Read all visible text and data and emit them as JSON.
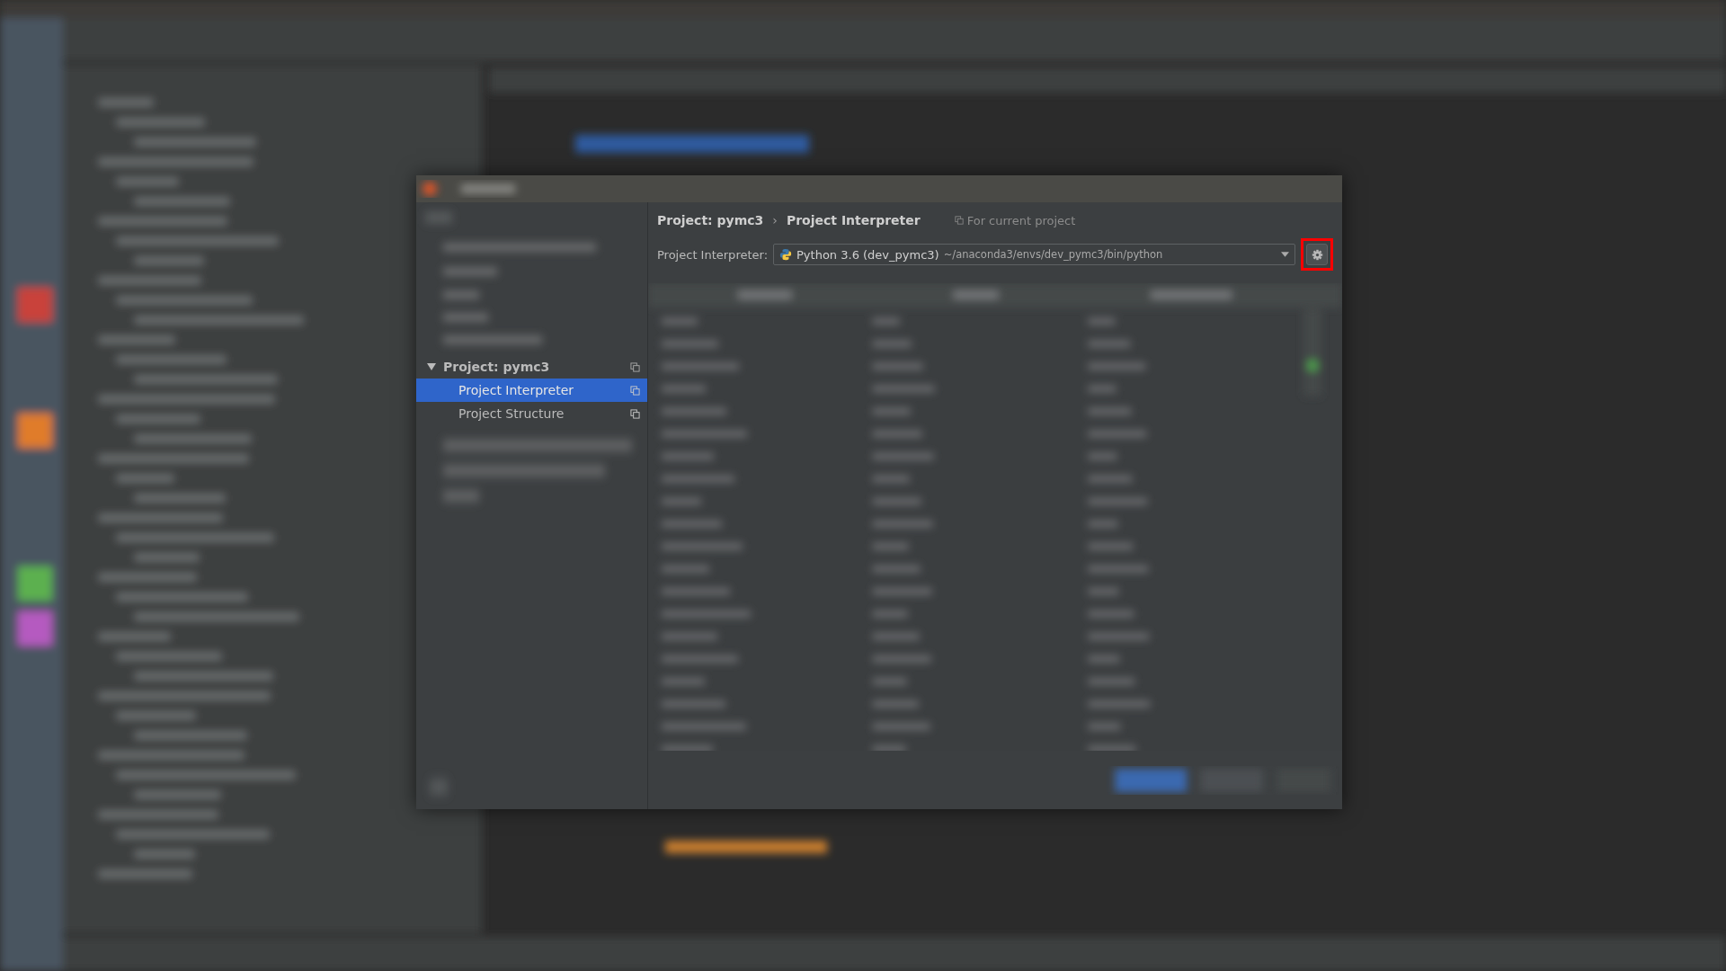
{
  "breadcrumb": {
    "items": [
      "Project: pymc3",
      "Project Interpreter"
    ],
    "separator": "›"
  },
  "scope_note": "For current project",
  "interpreter": {
    "label": "Project Interpreter:",
    "name": "Python 3.6 (dev_pymc3)",
    "path": "~/anaconda3/envs/dev_pymc3/bin/python",
    "highlighted": true
  },
  "sidebar": {
    "items": [
      {
        "label": "Project: pymc3",
        "expanded": true,
        "selected": false,
        "children": [
          {
            "label": "Project Interpreter",
            "selected": true
          },
          {
            "label": "Project Structure",
            "selected": false
          }
        ]
      }
    ]
  }
}
